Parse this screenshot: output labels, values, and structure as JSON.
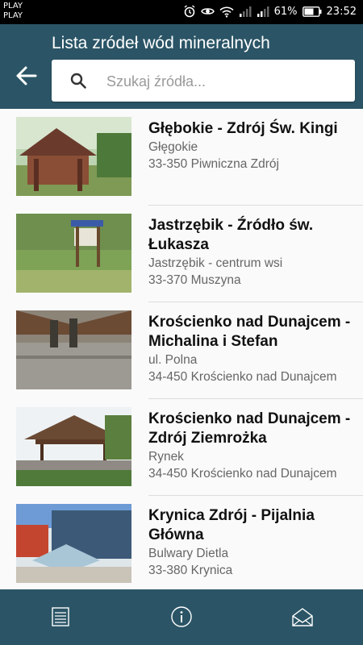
{
  "status_bar": {
    "carrier_line1": "PLAY",
    "carrier_line2": "PLAY",
    "battery": "61%",
    "time": "23:52"
  },
  "header": {
    "title": "Lista zródeł wód mineralnych",
    "search_placeholder": "Szukaj źródła..."
  },
  "springs": [
    {
      "name": "Głębokie - Zdrój Św. Kingi",
      "line1": "Głęgokie",
      "line2": "33-350 Piwniczna Zdrój"
    },
    {
      "name": "Jastrzębik - Źródło św. Łukasza",
      "line1": "Jastrzębik - centrum wsi",
      "line2": "33-370 Muszyna"
    },
    {
      "name": "Krościenko nad Dunajcem - Michalina i Stefan",
      "line1": "ul. Polna",
      "line2": "34-450 Krościenko nad Dunajcem"
    },
    {
      "name": "Krościenko nad Dunajcem - Zdrój Ziemrożka",
      "line1": "Rynek",
      "line2": "34-450 Krościenko nad Dunajcem"
    },
    {
      "name": "Krynica Zdrój - Pijalnia Główna",
      "line1": "Bulwary Dietla",
      "line2": "33-380 Krynica"
    }
  ],
  "bottom_nav": [
    "list-icon",
    "info-icon",
    "mail-icon"
  ],
  "colors": {
    "primary": "#2b5566",
    "background": "#fafafa"
  }
}
